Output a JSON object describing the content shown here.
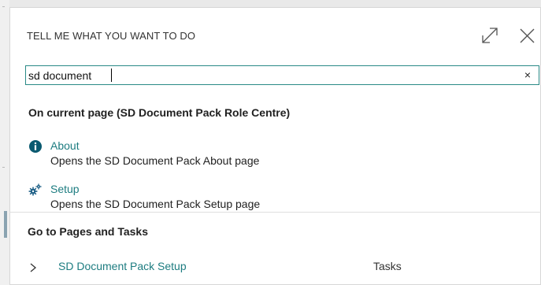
{
  "dialog": {
    "title": "TELL ME WHAT YOU WANT TO DO",
    "expand_icon": "expand-icon",
    "close_icon": "close-icon"
  },
  "search": {
    "value": "sd document",
    "clear_label": "×"
  },
  "current_page_section": {
    "header": "On current page (SD Document Pack Role Centre)",
    "results": [
      {
        "icon": "info-icon",
        "title": "About",
        "description": "Opens the SD Document Pack About page"
      },
      {
        "icon": "setup-icon",
        "title": "Setup",
        "description": "Opens the SD Document Pack Setup page"
      }
    ]
  },
  "pages_section": {
    "header": "Go to Pages and Tasks",
    "items": [
      {
        "icon": "chevron-right-icon",
        "name": "SD Document Pack Setup",
        "category": "Tasks"
      }
    ]
  },
  "colors": {
    "accent": "#1d7c80",
    "input_border": "#2a8a86",
    "info_icon": "#0a5a70"
  }
}
